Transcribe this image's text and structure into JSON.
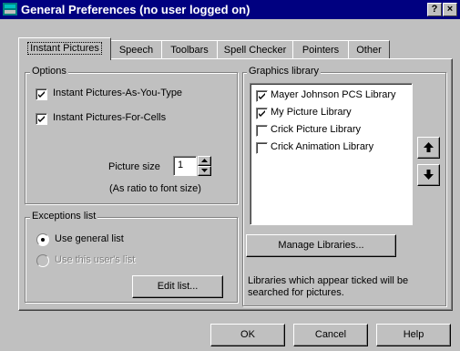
{
  "window": {
    "title": "General Preferences (no user logged on)",
    "help_button": "?",
    "close_button": "×"
  },
  "tabs": [
    {
      "label": "Instant Pictures",
      "active": true
    },
    {
      "label": "Speech",
      "active": false
    },
    {
      "label": "Toolbars",
      "active": false
    },
    {
      "label": "Spell Checker",
      "active": false
    },
    {
      "label": "Pointers",
      "active": false
    },
    {
      "label": "Other",
      "active": false
    }
  ],
  "options": {
    "group_label": "Options",
    "items": [
      {
        "label": "Instant Pictures-As-You-Type",
        "checked": true
      },
      {
        "label": "Instant Pictures-For-Cells",
        "checked": true
      }
    ],
    "picture_size_label": "Picture size",
    "picture_size_value": "1",
    "ratio_note": "(As ratio to font size)"
  },
  "exceptions": {
    "group_label": "Exceptions list",
    "radios": [
      {
        "label": "Use general list",
        "selected": true,
        "enabled": true
      },
      {
        "label": "Use this user's list",
        "selected": false,
        "enabled": false
      }
    ],
    "edit_button": "Edit list..."
  },
  "graphics": {
    "group_label": "Graphics library",
    "libraries": [
      {
        "label": "Mayer Johnson PCS Library",
        "checked": true
      },
      {
        "label": "My Picture Library",
        "checked": true
      },
      {
        "label": "Crick Picture Library",
        "checked": false
      },
      {
        "label": "Crick Animation Library",
        "checked": false
      }
    ],
    "manage_button": "Manage Libraries...",
    "note": "Libraries which appear ticked will be searched for pictures.",
    "up_icon": "arrow-up-icon",
    "down_icon": "arrow-down-icon"
  },
  "footer": {
    "ok": "OK",
    "cancel": "Cancel",
    "help": "Help"
  }
}
